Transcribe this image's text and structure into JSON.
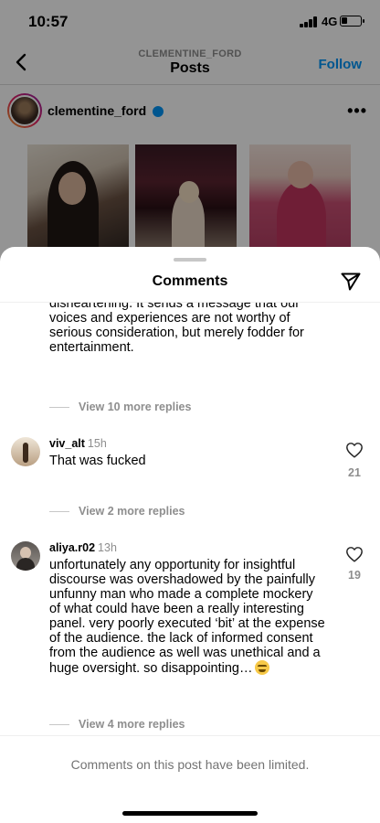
{
  "status_bar": {
    "time": "10:57",
    "network": "4G"
  },
  "nav": {
    "account": "CLEMENTINE_FORD",
    "title": "Posts",
    "follow_label": "Follow"
  },
  "post": {
    "username": "clementine_ford",
    "more": "•••"
  },
  "comments_sheet": {
    "title": "Comments",
    "partial_comment": {
      "text": "disheartening. It sends a message that our voices and experiences are not worthy of serious consideration, but merely fodder for entertainment."
    },
    "view_replies_1": "View 10 more replies",
    "comments": [
      {
        "username": "viv_alt",
        "time": "15h",
        "text": "That was fucked",
        "likes": "21"
      },
      {
        "username": "aliya.r02",
        "time": "13h",
        "text": "unfortunately any opportunity for insightful discourse was overshadowed by the painfully unfunny man who made a complete mockery of what could have been a really interesting panel. very poorly executed ‘bit’ at the expense of the audience. the lack of informed consent from the audience as well was unethical and a huge oversight. so disappointing…",
        "likes": "19"
      }
    ],
    "view_replies_2": "View 2 more replies",
    "view_replies_3": "View 4 more replies",
    "limited_note": "Comments on this post have been limited."
  },
  "icons": {
    "back": "chevron-left-icon",
    "share": "paper-plane-icon",
    "like": "heart-icon",
    "more": "more-horizontal-icon",
    "verified": "verified-badge-icon"
  },
  "colors": {
    "accent": "#0095f6",
    "muted_text": "#8e8e8e",
    "overlay": "rgba(0,0,0,0.42)"
  }
}
